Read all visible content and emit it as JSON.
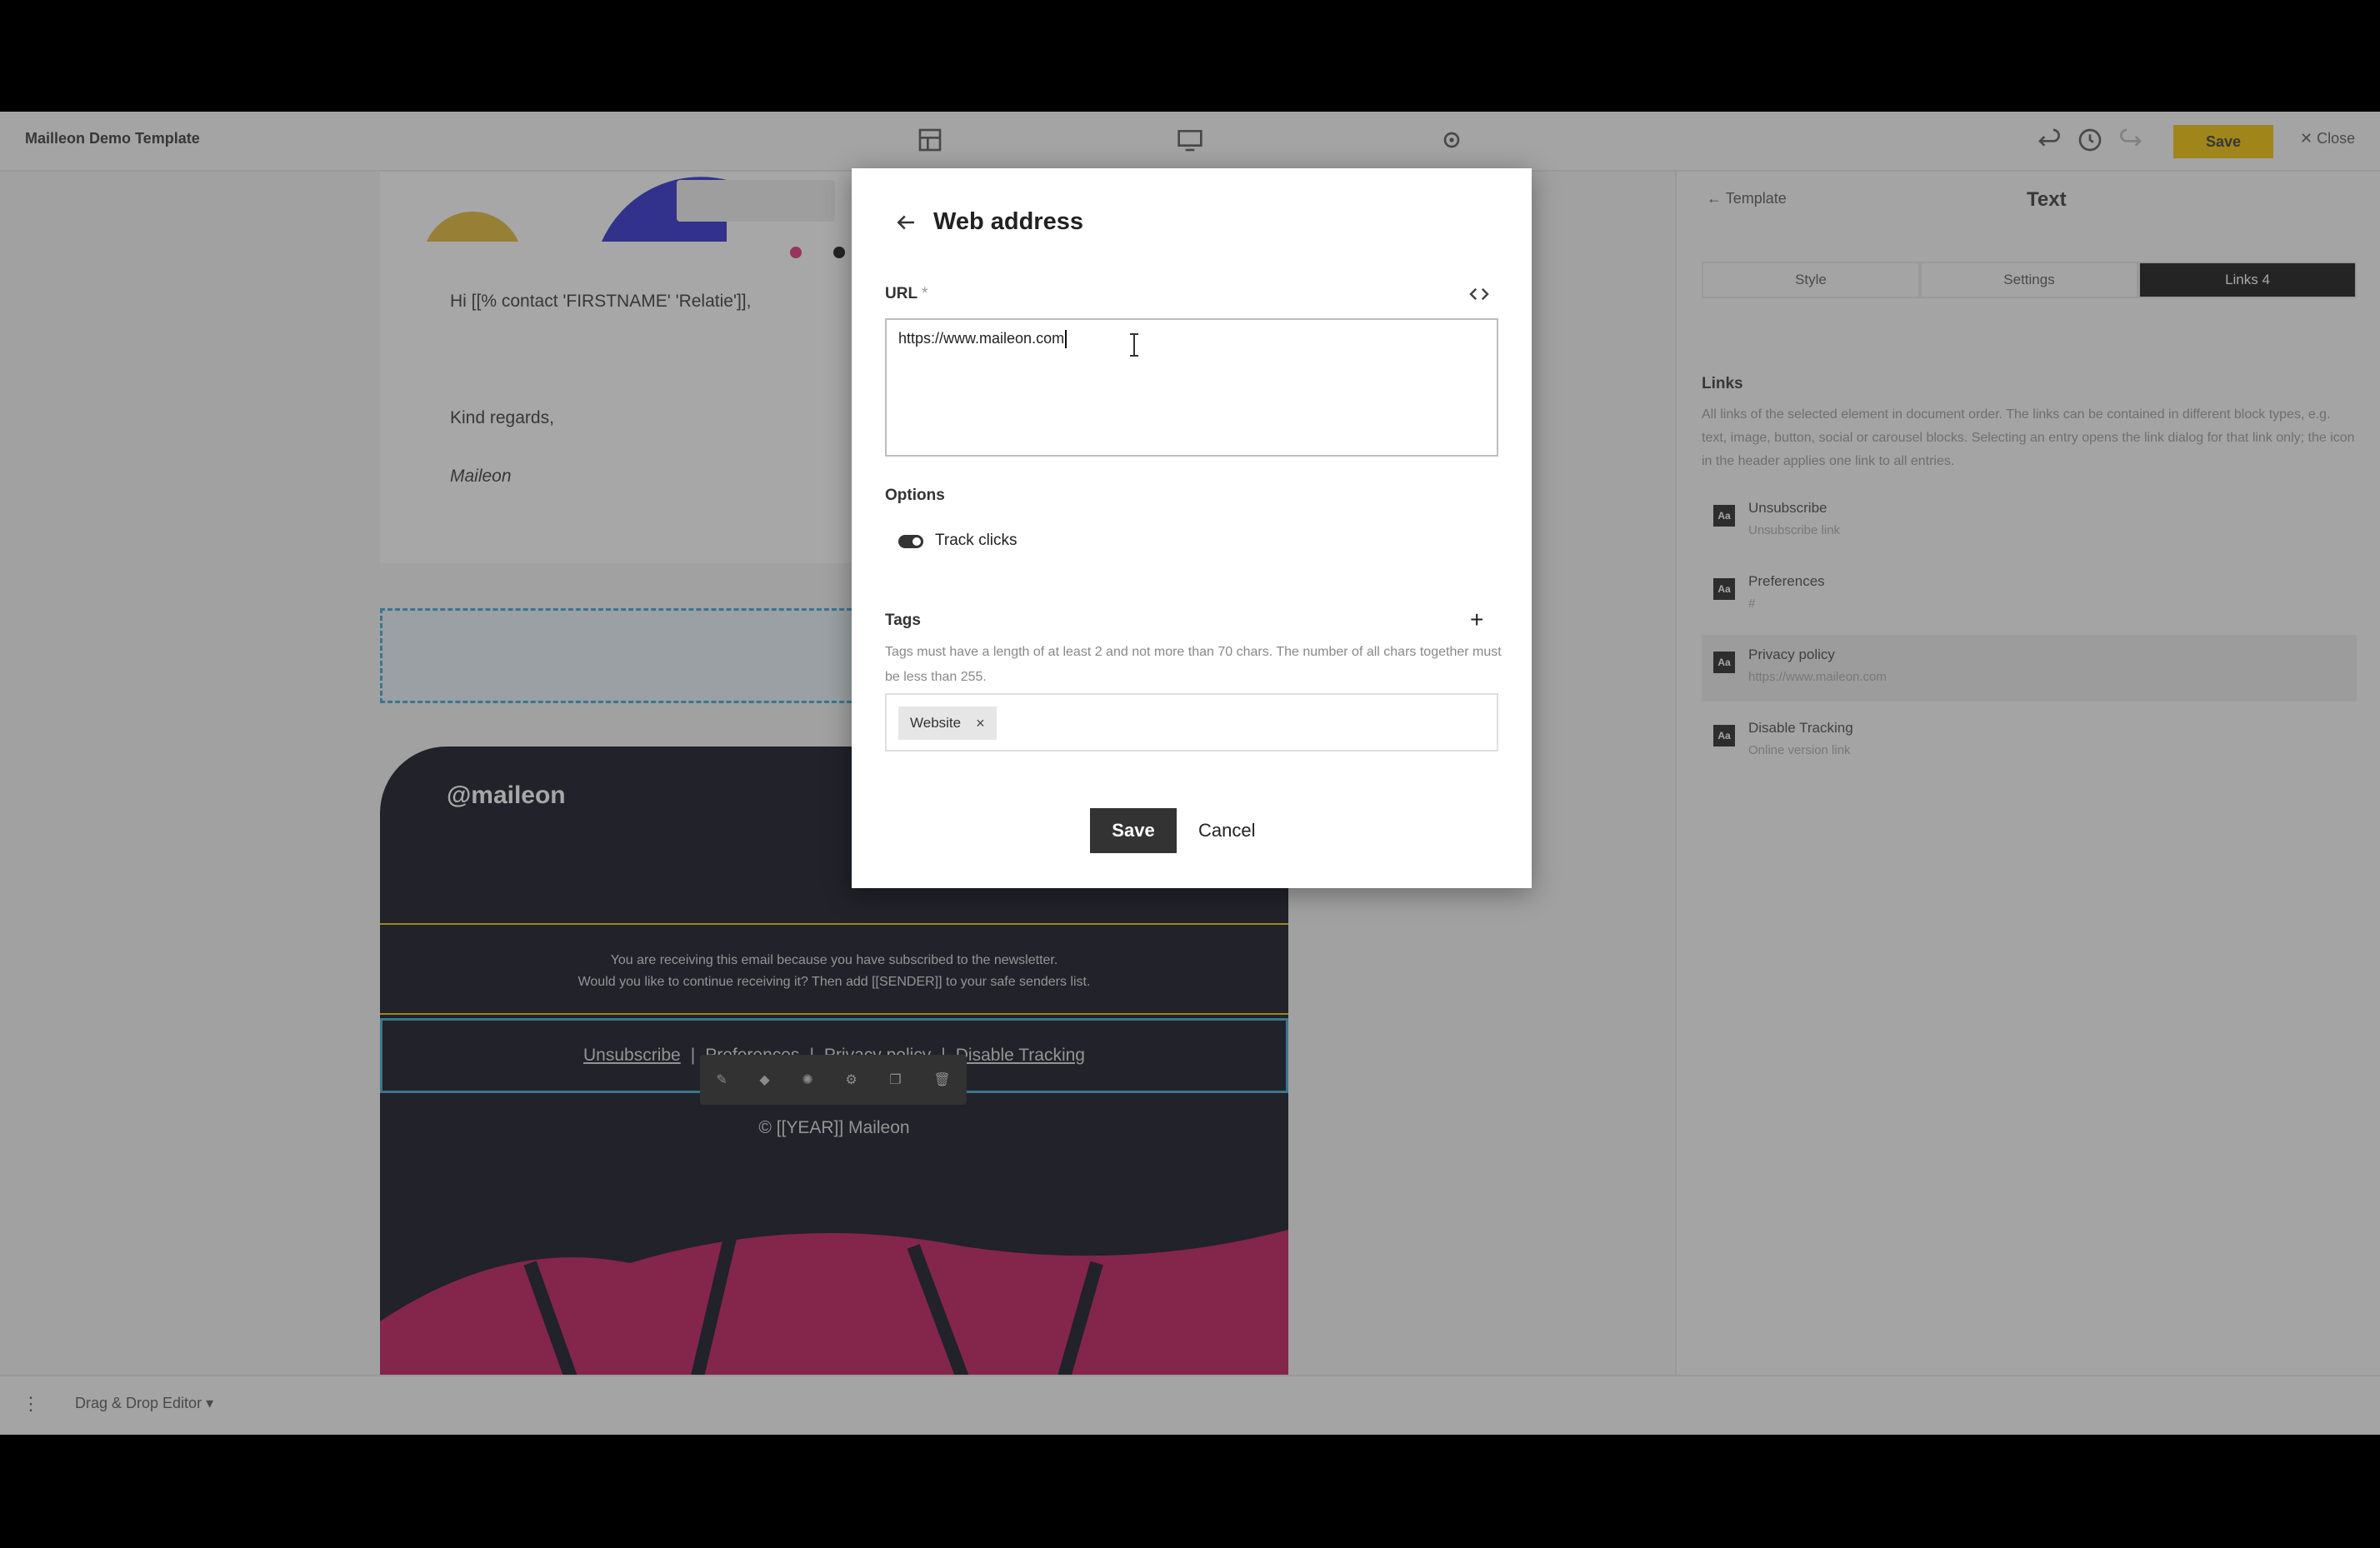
{
  "app": {
    "title": "Mailleon Demo Template",
    "save_label": "Save",
    "close_label": "Close",
    "editor_mode": "Drag & Drop Editor"
  },
  "email": {
    "greeting": "Hi [[% contact 'FIRSTNAME' 'Relatie']],",
    "closing": "Kind regards,",
    "signature": "Maileon",
    "footer_logo": "maileon",
    "notice_line1": "You are receiving this email because you have subscribed to the newsletter.",
    "notice_line2": "Would you like to continue receiving it? Then add [[SENDER]] to your safe senders list.",
    "links": [
      "Unsubscribe",
      "Preferences",
      "Privacy policy",
      "Disable Tracking"
    ],
    "separator": "|",
    "copyright": "© [[YEAR]] Maileon"
  },
  "right_panel": {
    "back_label": "Template",
    "title": "Text",
    "tabs": [
      {
        "label": "Style"
      },
      {
        "label": "Settings"
      },
      {
        "label": "Links 4"
      }
    ],
    "links_title": "Links",
    "links_description": "All links of the selected element in document order. The links can be contained in different block types, e.g. text, image, button, social or carousel blocks. Selecting an entry opens the link dialog for that link only; the icon in the header applies one link to all entries.",
    "items": [
      {
        "title": "Unsubscribe",
        "sub": "Unsubscribe link"
      },
      {
        "title": "Preferences",
        "sub": "#"
      },
      {
        "title": "Privacy policy",
        "sub": "https://www.maileon.com"
      },
      {
        "title": "Disable Tracking",
        "sub": "Online version link"
      }
    ],
    "item_icon": "Aa"
  },
  "modal": {
    "title": "Web address",
    "url_label": "URL",
    "required_mark": "*",
    "url_value": "https://www.maileon.com",
    "options_label": "Options",
    "track_clicks_label": "Track clicks",
    "track_clicks_on": true,
    "tags_label": "Tags",
    "tags_help": "Tags must have a length of at least 2 and not more than 70 chars. The number of all chars together must be less than 255.",
    "tags": [
      "Website"
    ],
    "tag_remove": "×",
    "save_label": "Save",
    "cancel_label": "Cancel"
  }
}
